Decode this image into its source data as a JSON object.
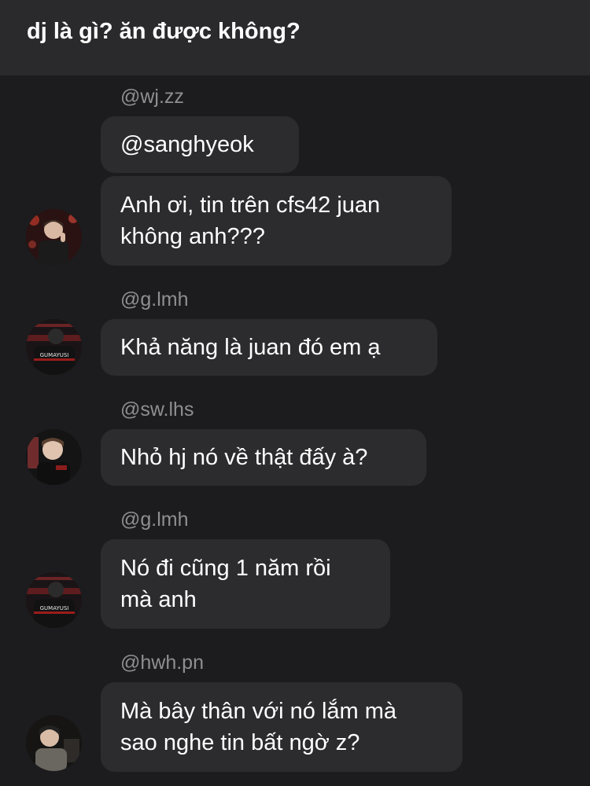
{
  "header": {
    "title": "dj là gì? ăn được không?"
  },
  "messages": [
    {
      "sender": "@wj.zz",
      "text": "@sanghyeok"
    },
    {
      "sender": "",
      "text": "Anh ơi, tin trên cfs42 juan\nkhông anh???"
    },
    {
      "sender": "@g.lmh",
      "text": "Khả năng là juan đó em ạ"
    },
    {
      "sender": "@sw.lhs",
      "text": "Nhỏ hj nó về thật đấy à?"
    },
    {
      "sender": "@g.lmh",
      "text": "Nó đi cũng 1 năm rồi\nmà anh"
    },
    {
      "sender": "@hwh.pn",
      "text": "Mà bây thân với nó lắm mà\nsao nghe tin bất ngờ z?"
    }
  ],
  "avatars": {
    "jersey_text": "GUMAYUSI"
  },
  "colors": {
    "background": "#1c1c1e",
    "header": "#2a2a2c",
    "bubble": "#2c2c2e",
    "sender": "#8e8e93",
    "text": "#ffffff"
  }
}
